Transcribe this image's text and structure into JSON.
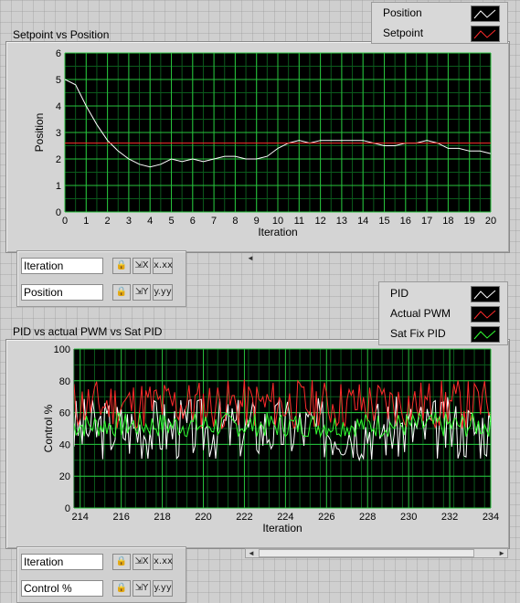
{
  "chart1": {
    "title": "Setpoint vs Position",
    "legend": [
      {
        "label": "Position",
        "color": "#ffffff"
      },
      {
        "label": "Setpoint",
        "color": "#ff2b2b"
      }
    ],
    "scale_names": [
      "Iteration",
      "Position"
    ]
  },
  "chart2": {
    "title": "PID  vs actual PWM vs Sat PID",
    "legend": [
      {
        "label": "PID",
        "color": "#ffffff"
      },
      {
        "label": "Actual PWM",
        "color": "#ff2b2b"
      },
      {
        "label": "Sat Fix PID",
        "color": "#32ff32"
      }
    ],
    "scale_names": [
      "Iteration",
      "Control %"
    ]
  },
  "scale_buttons": {
    "lock": "🔒",
    "x_autoscale": "⇲X",
    "y_autoscale": "⇲Y",
    "x_format": "x.xx",
    "y_format": "y.yy"
  },
  "chart_data": [
    {
      "type": "line",
      "title": "Setpoint vs Position",
      "xlabel": "Iteration",
      "ylabel": "Position",
      "xlim": [
        0,
        20
      ],
      "ylim": [
        0,
        6
      ],
      "x_ticks": [
        0,
        1,
        2,
        3,
        4,
        5,
        6,
        7,
        8,
        9,
        10,
        11,
        12,
        13,
        14,
        15,
        16,
        17,
        18,
        19,
        20
      ],
      "y_ticks": [
        0,
        1,
        2,
        3,
        4,
        5,
        6
      ],
      "grid": true,
      "legend_placement": "top-right, outside",
      "series": [
        {
          "name": "Position",
          "color": "#ffffff",
          "x": [
            0,
            0.5,
            1,
            1.5,
            2,
            2.5,
            3,
            3.5,
            4,
            4.5,
            5,
            5.5,
            6,
            6.5,
            7,
            7.5,
            8,
            8.5,
            9,
            9.5,
            10,
            10.5,
            11,
            11.5,
            12,
            12.5,
            13,
            13.5,
            14,
            14.5,
            15,
            15.5,
            16,
            16.5,
            17,
            17.5,
            18,
            18.5,
            19,
            19.5,
            20
          ],
          "y": [
            5.0,
            4.8,
            4.0,
            3.3,
            2.7,
            2.3,
            2.0,
            1.8,
            1.7,
            1.8,
            2.0,
            1.9,
            2.0,
            1.9,
            2.0,
            2.1,
            2.1,
            2.0,
            2.0,
            2.1,
            2.4,
            2.6,
            2.7,
            2.6,
            2.7,
            2.7,
            2.7,
            2.7,
            2.7,
            2.6,
            2.5,
            2.5,
            2.6,
            2.6,
            2.7,
            2.6,
            2.4,
            2.4,
            2.3,
            2.3,
            2.2
          ]
        },
        {
          "name": "Setpoint",
          "color": "#ff2b2b",
          "x": [
            0,
            20
          ],
          "y": [
            2.6,
            2.6
          ]
        }
      ]
    },
    {
      "type": "line",
      "title": "PID  vs actual PWM vs Sat PID",
      "xlabel": "Iteration",
      "ylabel": "Control %",
      "xlim": [
        213.7,
        234
      ],
      "ylim": [
        0,
        100
      ],
      "x_ticks": [
        214,
        216,
        218,
        220,
        222,
        224,
        226,
        228,
        230,
        232,
        234
      ],
      "y_ticks": [
        0,
        20,
        40,
        60,
        80,
        100
      ],
      "grid": true,
      "legend_placement": "top-right, outside",
      "series": [
        {
          "name": "PID",
          "color": "#ffffff",
          "base": 50,
          "amp": 10,
          "seed": 3
        },
        {
          "name": "Actual PWM",
          "color": "#ff2b2b",
          "base": 65,
          "amp": 8,
          "seed": 11
        },
        {
          "name": "Sat Fix PID",
          "color": "#32ff32",
          "base": 52,
          "amp": 4,
          "seed": 7
        }
      ]
    }
  ]
}
